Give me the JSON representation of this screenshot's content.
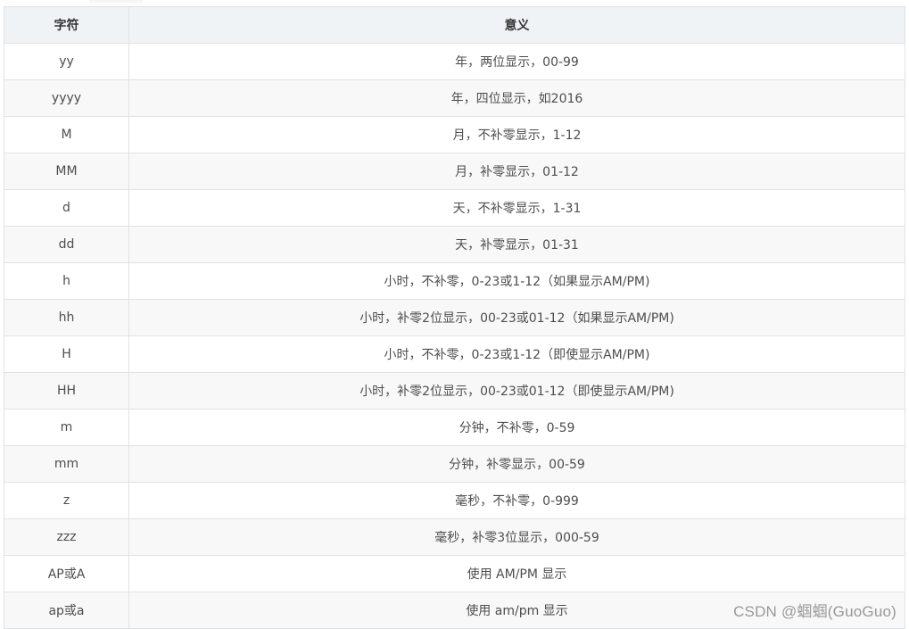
{
  "table": {
    "headers": [
      "字符",
      "意义"
    ],
    "rows": [
      [
        "yy",
        "年，两位显示，00-99"
      ],
      [
        "yyyy",
        "年，四位显示，如2016"
      ],
      [
        "M",
        "月，不补零显示，1-12"
      ],
      [
        "MM",
        "月，补零显示，01-12"
      ],
      [
        "d",
        "天，不补零显示，1-31"
      ],
      [
        "dd",
        "天，补零显示，01-31"
      ],
      [
        "h",
        "小时，不补零，0-23或1-12（如果显示AM/PM)"
      ],
      [
        "hh",
        "小时，补零2位显示，00-23或01-12（如果显示AM/PM)"
      ],
      [
        "H",
        "小时，不补零，0-23或1-12（即使显示AM/PM)"
      ],
      [
        "HH",
        "小时，补零2位显示，00-23或01-12（即使显示AM/PM)"
      ],
      [
        "m",
        "分钟，不补零，0-59"
      ],
      [
        "mm",
        "分钟，补零显示，00-59"
      ],
      [
        "z",
        "毫秒，不补零，0-999"
      ],
      [
        "zzz",
        "毫秒，补零3位显示，000-59"
      ],
      [
        "AP或A",
        "使用 AM/PM 显示"
      ],
      [
        "ap或a",
        "使用 am/pm 显示"
      ]
    ]
  },
  "watermark": "CSDN @蝈蝈(GuoGuo)",
  "colors": {
    "header_bg": "#eff3f5",
    "stripe_bg": "#f8f8f8",
    "border": "#dfe2e5",
    "text": "#4d4d4d"
  }
}
